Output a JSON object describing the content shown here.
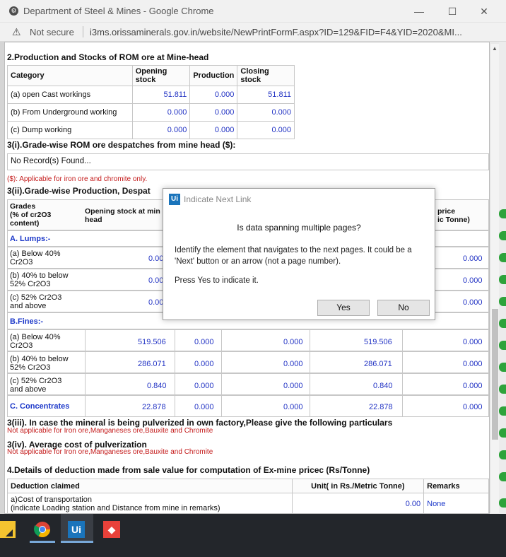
{
  "window": {
    "title": "Department of Steel & Mines - Google Chrome",
    "not_secure": "Not secure",
    "url": "i3ms.orissaminerals.gov.in/website/NewPrintFormF.aspx?ID=129&FID=F4&YID=2020&MI..."
  },
  "s2": {
    "heading": "2.Production and Stocks of ROM ore at Mine-head",
    "headers": [
      "Category",
      "Opening stock",
      "Production",
      "Closing stock"
    ],
    "rows": [
      {
        "label": "(a) open Cast workings",
        "v1": "51.811",
        "v2": "0.000",
        "v3": "51.811"
      },
      {
        "label": "(b) From Underground working",
        "v1": "0.000",
        "v2": "0.000",
        "v3": "0.000"
      },
      {
        "label": "(c) Dump working",
        "v1": "0.000",
        "v2": "0.000",
        "v3": "0.000"
      }
    ]
  },
  "s3i": {
    "heading": "3(i).Grade-wise ROM ore despatches from mine head ($):",
    "no_record": "No Record(s) Found...",
    "note": "($): Applicable for iron ore and chromite only."
  },
  "s3ii": {
    "heading": "3(ii).Grade-wise Production, Despat",
    "col1": "Grades\n(% of cr2O3\ncontent)",
    "col2": "Opening stock at min\nhead",
    "col_last": "price\nic Tonne)",
    "lumps_label": "A. Lumps:-",
    "fines_label": "B.Fines:-",
    "concentrates_label": "C. Concentrates",
    "lumps": [
      {
        "label": "(a) Below 40%\nCr2O3",
        "v1": "0.00",
        "v5": "0.000"
      },
      {
        "label": "(b) 40% to below\n52% Cr2O3",
        "v1": "0.00",
        "v5": "0.000"
      },
      {
        "label": "(c) 52% Cr2O3\nand above",
        "v1": "0.00",
        "v5": "0.000"
      }
    ],
    "fines": [
      {
        "label": "(a) Below 40%\nCr2O3",
        "v1": "519.506",
        "v2": "0.000",
        "v3": "0.000",
        "v4": "519.506",
        "v5": "0.000"
      },
      {
        "label": "(b) 40% to below\n52% Cr2O3",
        "v1": "286.071",
        "v2": "0.000",
        "v3": "0.000",
        "v4": "286.071",
        "v5": "0.000"
      },
      {
        "label": "(c) 52% Cr2O3\nand above",
        "v1": "0.840",
        "v2": "0.000",
        "v3": "0.000",
        "v4": "0.840",
        "v5": "0.000"
      }
    ],
    "concentrates": {
      "v1": "22.878",
      "v2": "0.000",
      "v3": "0.000",
      "v4": "22.878",
      "v5": "0.000"
    }
  },
  "s3iii": {
    "heading": "3(iii). In case the mineral is being pulverized in own factory,Please give the following particulars",
    "note": "Not applicable for Iron ore,Manganeses ore,Bauxite and Chromite"
  },
  "s3iv": {
    "heading": "3(iv). Average cost of pulverization",
    "note": "Not applicable for Iron ore,Manganeses ore,Bauxite and Chromite"
  },
  "s4": {
    "heading": "4.Details of deduction made from sale value for computation of Ex-mine pricec (Rs/Tonne)",
    "headers": [
      "Deduction claimed",
      "Unit( in Rs./Metric Tonne)",
      "Remarks"
    ],
    "row_label": "a)Cost of transportation\n(indicate Loading station and Distance from mine in remarks)",
    "row_value": "0.00",
    "row_remarks": "None"
  },
  "dialog": {
    "title": "Indicate Next Link",
    "question": "Is data spanning multiple pages?",
    "text": "Identify the element that navigates to the next pages. It could be a 'Next' button or an arrow (not a page number).",
    "text2": "Press Yes to indicate it.",
    "yes": "Yes",
    "no": "No"
  },
  "taskbar": {
    "icons": [
      "sticky-notes-icon",
      "chrome-icon",
      "uipath-icon",
      "anydesk-icon"
    ]
  }
}
